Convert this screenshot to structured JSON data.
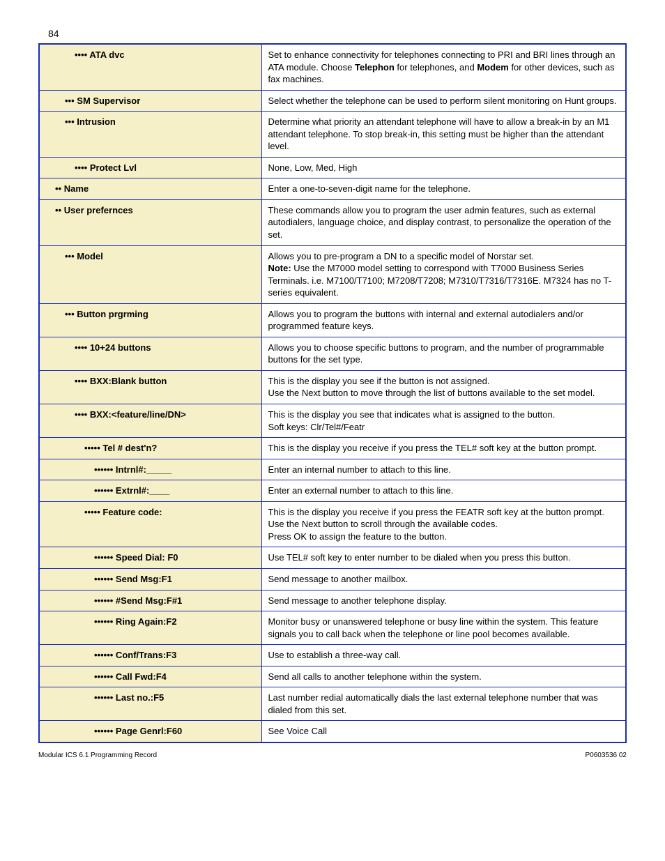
{
  "page_number": "84",
  "rows": [
    {
      "indent": 4,
      "label": "ATA dvc",
      "desc": "Set to enhance connectivity for telephones connecting to PRI and BRI lines through an ATA module. Choose <b>Telephon</b> for telephones, and <b>Modem</b> for other devices, such as fax machines."
    },
    {
      "indent": 3,
      "label": "SM Supervisor",
      "desc": "Select whether the telephone can be used to perform silent monitoring on Hunt groups."
    },
    {
      "indent": 3,
      "label": "Intrusion",
      "desc": "Determine what priority an attendant telephone will have to allow a break-in by an M1 attendant telephone. To stop break-in, this setting must be higher than the attendant level."
    },
    {
      "indent": 4,
      "label": "Protect Lvl",
      "desc": "None, Low, Med, High"
    },
    {
      "indent": 2,
      "label": "Name",
      "desc": "Enter a one-to-seven-digit name for the telephone."
    },
    {
      "indent": 2,
      "label": "User prefernces",
      "desc": "These commands allow you to program the user admin features, such as external autodialers, language choice, and display contrast, to personalize the operation of the set."
    },
    {
      "indent": 3,
      "label": "Model",
      "desc": "Allows you to pre-program a DN to a specific model of Norstar set.<br><b>Note:</b> Use the M7000 model setting to correspond with T7000 Business Series Terminals. i.e. M7100/T7100; M7208/T7208; M7310/T7316/T7316E. M7324 has no T-series equivalent."
    },
    {
      "indent": 3,
      "label": "Button prgrming",
      "desc": "Allows you to program the buttons with internal and external autodialers and/or programmed feature keys."
    },
    {
      "indent": 4,
      "label": "10+24 buttons",
      "desc": "Allows you to choose specific buttons to program, and the number of programmable buttons for the set type."
    },
    {
      "indent": 4,
      "label": "BXX:Blank button",
      "desc": "This is the display you see if the button is not assigned.<br>Use the Next button to move through the list of buttons available to the set model."
    },
    {
      "indent": 4,
      "label": "BXX:&lt;feature/line/DN&gt;",
      "desc": "This is the display you see that indicates what is assigned to the button.<br>Soft keys: Clr/Tel#/Featr"
    },
    {
      "indent": 5,
      "label": "Tel # dest'n?",
      "desc": "This is the display you receive if you press the TEL# soft key at the button prompt."
    },
    {
      "indent": 6,
      "label": "Intrnl#:_____",
      "desc": "Enter an internal number to attach to this line."
    },
    {
      "indent": 6,
      "label": "Extrnl#:____",
      "desc": "Enter an external number to attach to this line."
    },
    {
      "indent": 5,
      "label": "Feature code:",
      "desc": "This is the display you receive if you press the FEATR soft key at the button prompt. Use the Next button to scroll through the available codes.<br>Press OK to assign the feature to the button."
    },
    {
      "indent": 6,
      "label": "Speed Dial: F0",
      "desc": "Use TEL# soft key to enter number to be dialed when you press this button."
    },
    {
      "indent": 6,
      "label": "Send Msg:F1",
      "desc": "Send message to another mailbox."
    },
    {
      "indent": 6,
      "label": "#Send Msg:F#1",
      "desc": "Send message to another telephone display."
    },
    {
      "indent": 6,
      "label": "Ring Again:F2",
      "desc": "Monitor busy or unanswered telephone or busy line within the system. This feature signals you to call back when the telephone or line pool becomes available."
    },
    {
      "indent": 6,
      "label": "Conf/Trans:F3",
      "desc": "Use to establish a three-way call."
    },
    {
      "indent": 6,
      "label": "Call Fwd:F4",
      "desc": "Send all calls to another telephone within the system."
    },
    {
      "indent": 6,
      "label": "Last no.:F5",
      "desc": "Last number redial automatically dials the last external telephone number that was dialed from this set."
    },
    {
      "indent": 6,
      "label": "Page Genrl:F60",
      "desc": "See Voice Call"
    }
  ],
  "footer_left": "Modular ICS 6.1 Programming Record",
  "footer_right": "P0603536  02"
}
